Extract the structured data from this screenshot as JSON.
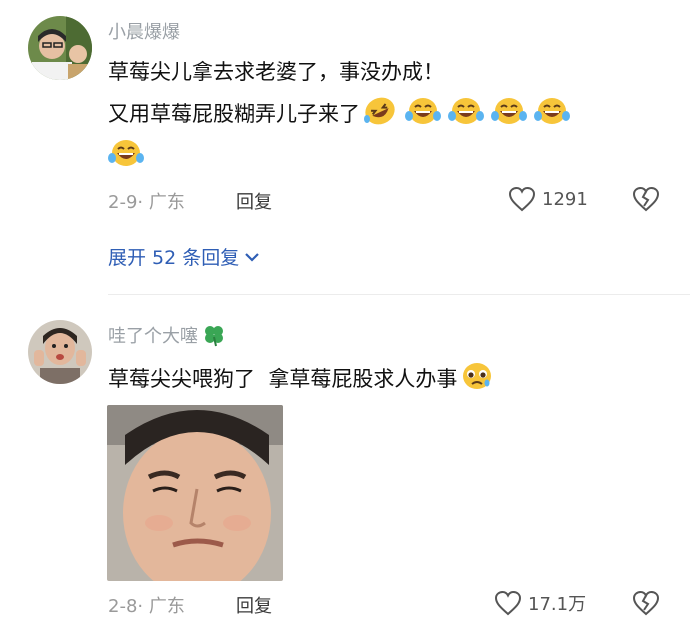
{
  "comments": [
    {
      "username": "小晨爆爆",
      "line1": "草莓尖儿拿去求老婆了，事没办成！",
      "line2": "又用草莓屁股糊弄儿子来了",
      "date": "2-9",
      "location": "· 广东",
      "reply_label": "回复",
      "likes": "1291",
      "emoji_icons": [
        "rolling-laughing-emoji",
        "tears-of-joy-emoji",
        "tears-of-joy-emoji",
        "tears-of-joy-emoji",
        "tears-of-joy-emoji",
        "tears-of-joy-emoji"
      ]
    },
    {
      "username": "哇了个大噻",
      "badge_icon": "four-leaf-clover-icon",
      "line1": "草莓尖尖喂狗了  拿草莓屁股求人办事",
      "emoji_icons": [
        "pleading-face-emoji"
      ],
      "date": "2-8",
      "location": "· 广东",
      "reply_label": "回复",
      "likes": "17.1万"
    }
  ],
  "expand_replies": "展开 52 条回复",
  "colors": {
    "link": "#2f5eb5",
    "meta": "#9a9a9a",
    "emoji": "#f7c53a"
  }
}
